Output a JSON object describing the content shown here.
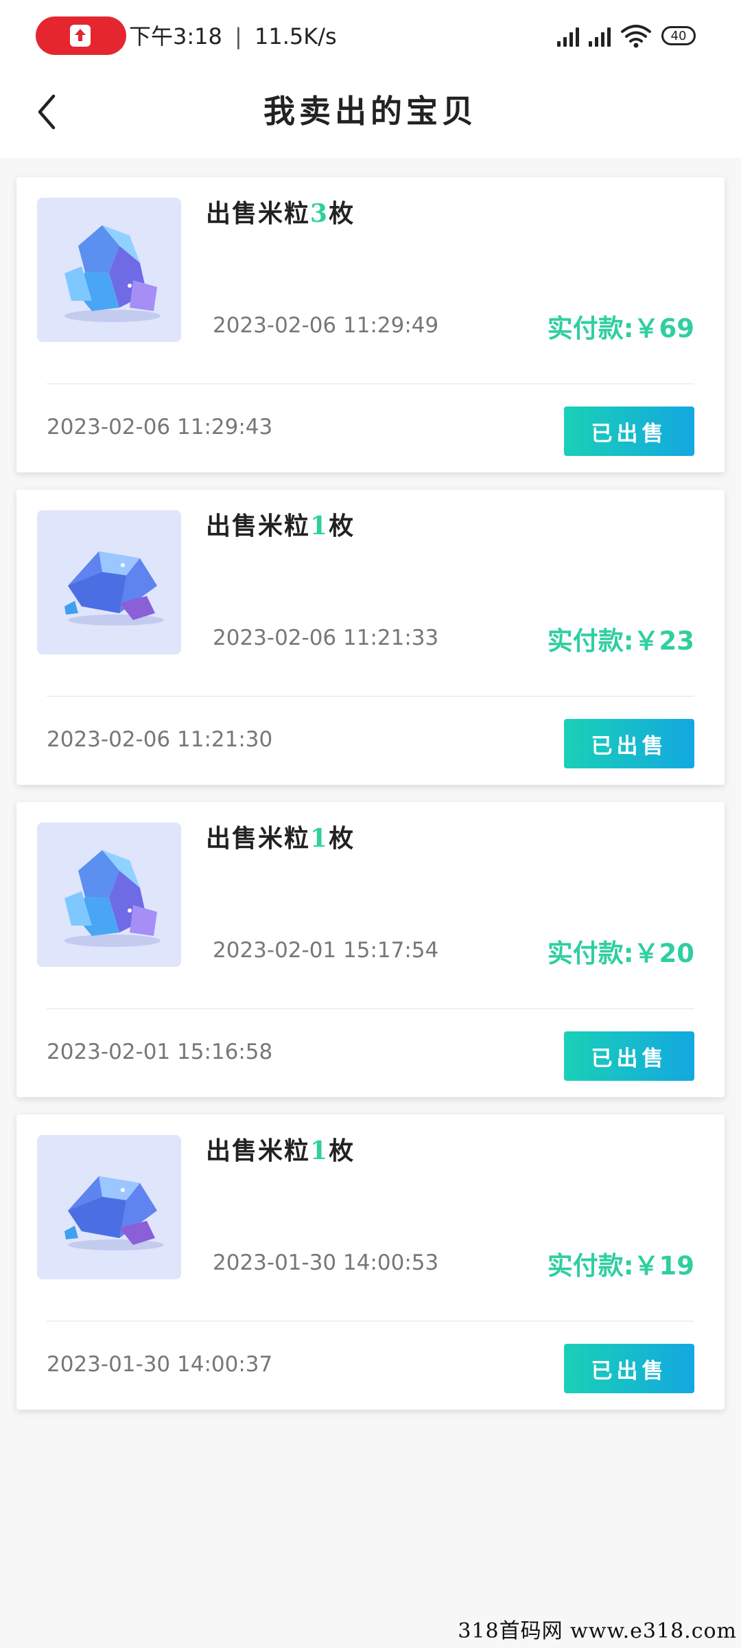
{
  "status_bar": {
    "time": "下午3:18",
    "separator": "|",
    "net_speed": "11.5K/s",
    "battery": "40"
  },
  "header": {
    "title": "我卖出的宝贝"
  },
  "paid_label": "实付款:",
  "orders": [
    {
      "title_prefix": "出售米粒",
      "quantity": "3",
      "title_suffix": "枚",
      "sold_time": "2023-02-06  11:29:49",
      "amount": "￥69",
      "order_time": "2023-02-06  11:29:43",
      "status": "已出售",
      "icon": "crystal-cluster-icon"
    },
    {
      "title_prefix": "出售米粒",
      "quantity": "1",
      "title_suffix": "枚",
      "sold_time": "2023-02-06  11:21:33",
      "amount": "￥23",
      "order_time": "2023-02-06  11:21:30",
      "status": "已出售",
      "icon": "gemstone-icon"
    },
    {
      "title_prefix": "出售米粒",
      "quantity": "1",
      "title_suffix": "枚",
      "sold_time": "2023-02-01  15:17:54",
      "amount": "￥20",
      "order_time": "2023-02-01  15:16:58",
      "status": "已出售",
      "icon": "crystal-cluster-icon"
    },
    {
      "title_prefix": "出售米粒",
      "quantity": "1",
      "title_suffix": "枚",
      "sold_time": "2023-01-30  14:00:53",
      "amount": "￥19",
      "order_time": "2023-01-30  14:00:37",
      "status": "已出售",
      "icon": "gemstone-icon"
    }
  ],
  "watermark": "318首码网  www.e318.com",
  "colors": {
    "accent_green": "#2fcf9f",
    "button_gradient_start": "#1ad0b6",
    "button_gradient_end": "#13a8e0",
    "record_pill": "#e5262f"
  }
}
